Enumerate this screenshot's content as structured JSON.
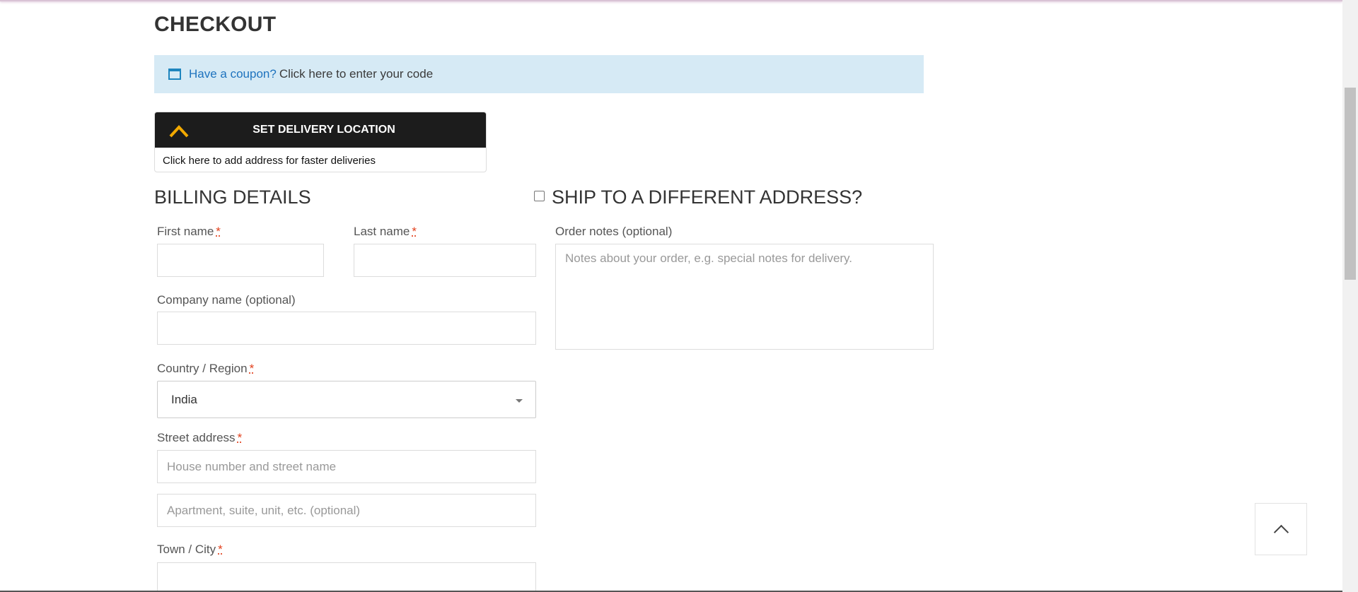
{
  "page": {
    "title": "CHECKOUT"
  },
  "coupon": {
    "link_text": "Have a coupon?",
    "text": "Click here to enter your code"
  },
  "delivery": {
    "title": "SET DELIVERY LOCATION",
    "subtitle": "Click here to add address for faster deliveries"
  },
  "billing": {
    "heading": "BILLING DETAILS",
    "required_mark": "*",
    "first_name": {
      "label": "First name",
      "value": ""
    },
    "last_name": {
      "label": "Last name",
      "value": ""
    },
    "company": {
      "label": "Company name (optional)",
      "value": ""
    },
    "country": {
      "label": "Country / Region",
      "selected": "India"
    },
    "street": {
      "label": "Street address",
      "placeholder1": "House number and street name",
      "placeholder2": "Apartment, suite, unit, etc. (optional)"
    },
    "city": {
      "label": "Town / City",
      "value": ""
    }
  },
  "shipping": {
    "heading": "SHIP TO A DIFFERENT ADDRESS?",
    "checked": false,
    "order_notes": {
      "label": "Order notes (optional)",
      "placeholder": "Notes about your order, e.g. special notes for delivery."
    }
  },
  "icons": {
    "coupon": "window-icon",
    "delivery_logo": "chevron-logo-icon",
    "scroll_top": "chevron-up-icon",
    "select_caret": "caret-down-icon"
  },
  "colors": {
    "coupon_bg": "#d6eaf5",
    "link": "#1e73be",
    "required": "#e2401c",
    "delivery_header_bg": "#1c1c1c",
    "delivery_logo": "#f2a900"
  }
}
